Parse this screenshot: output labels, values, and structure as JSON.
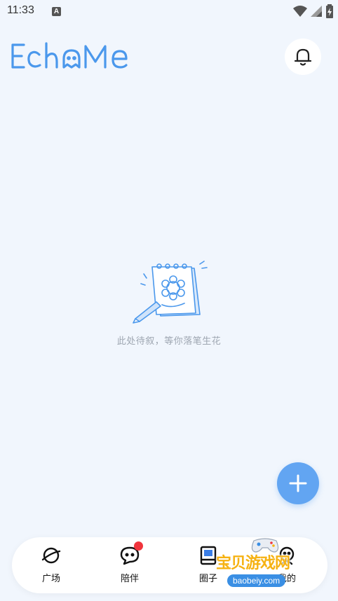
{
  "status_bar": {
    "time": "11:33",
    "notification_glyph": "A"
  },
  "header": {
    "logo_text": "EchoMe"
  },
  "empty_state": {
    "message": "此处待叙，等你落笔生花"
  },
  "bottom_nav": [
    {
      "label": "广场",
      "icon": "planet-icon"
    },
    {
      "label": "陪伴",
      "icon": "chat-bubble-icon"
    },
    {
      "label": "圈子",
      "icon": "book-icon"
    },
    {
      "label": "我的",
      "icon": "profile-icon"
    }
  ],
  "watermark": {
    "title": "宝贝游戏网",
    "url": "baobeiy.com"
  },
  "colors": {
    "accent": "#62a5f2",
    "logo": "#4b98ec",
    "badge": "#f0343c",
    "background": "#f1f6fd"
  }
}
